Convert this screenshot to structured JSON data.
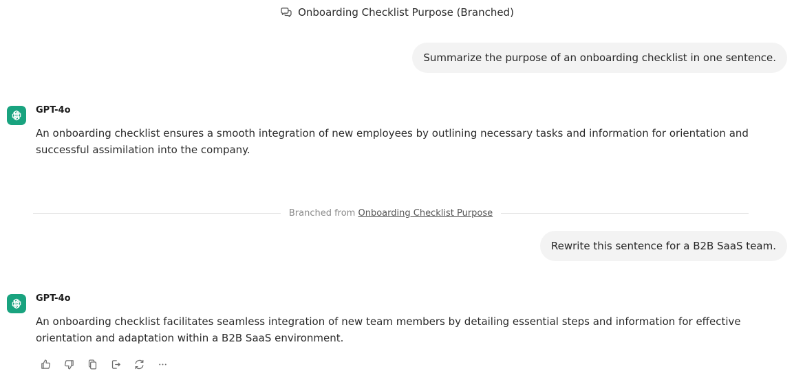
{
  "conversation": {
    "title": "Onboarding Checklist Purpose (Branched)"
  },
  "messages": [
    {
      "role": "user",
      "text": "Summarize the purpose of an onboarding checklist in one sentence."
    },
    {
      "role": "assistant",
      "model": "GPT-4o",
      "text": "An onboarding checklist ensures a smooth integration of new employees by outlining necessary tasks and information for orientation and successful assimilation into the company."
    },
    {
      "role": "user",
      "text": "Rewrite this sentence for a B2B SaaS team."
    },
    {
      "role": "assistant",
      "model": "GPT-4o",
      "text": "An onboarding checklist facilitates seamless integration of new team members by detailing essential steps and information for effective orientation and adaptation within a B2B SaaS environment."
    }
  ],
  "branch": {
    "prefix": "Branched from",
    "link_text": "Onboarding Checklist Purpose"
  },
  "actions": [
    {
      "icon": "thumbs-up-icon"
    },
    {
      "icon": "thumbs-down-icon"
    },
    {
      "icon": "copy-icon"
    },
    {
      "icon": "branch-icon"
    },
    {
      "icon": "regenerate-icon"
    },
    {
      "icon": "more-icon"
    }
  ],
  "colors": {
    "avatar_bg": "#19a37f",
    "user_bubble_bg": "#f3f3f3",
    "divider": "#e2e2e2"
  }
}
